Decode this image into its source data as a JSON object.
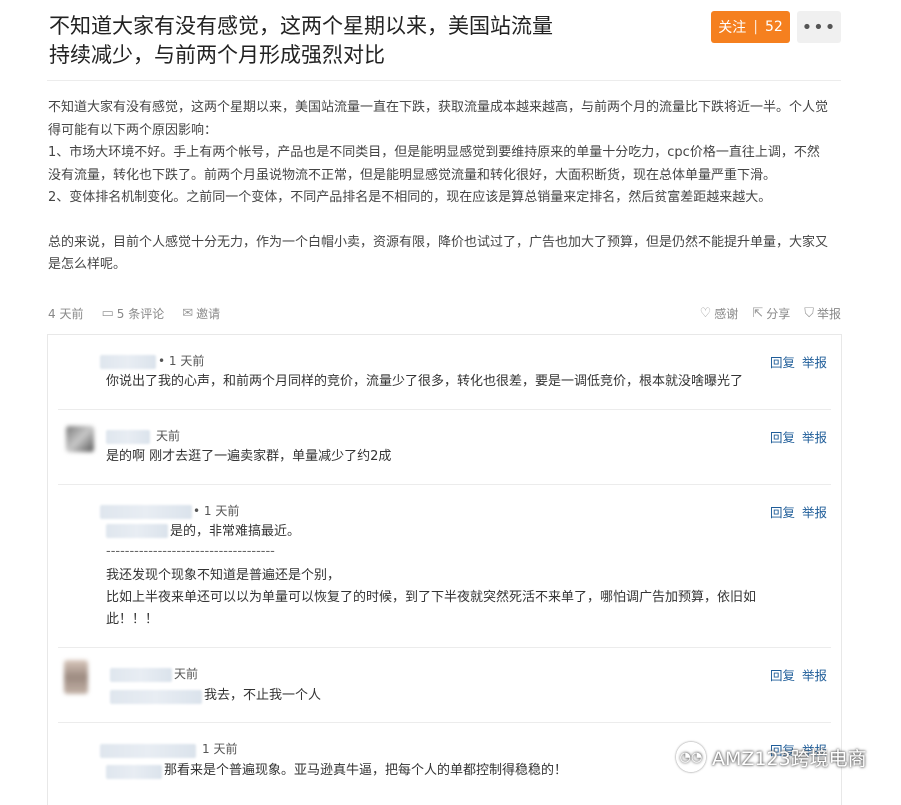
{
  "post": {
    "title": "不知道大家有没有感觉，这两个星期以来，美国站流量持续减少，与前两个月形成强烈对比",
    "follow_label": "关注",
    "follow_count": "52",
    "more_label": "•••",
    "paragraphs": [
      "不知道大家有没有感觉，这两个星期以来，美国站流量一直在下跌，获取流量成本越来越高，与前两个月的流量比下跌将近一半。个人觉得可能有以下两个原因影响：",
      "1、市场大环境不好。手上有两个帐号，产品也是不同类目，但是能明显感觉到要维持原来的单量十分吃力，cpc价格一直往上调，不然没有流量，转化也下跌了。前两个月虽说物流不正常，但是能明显感觉流量和转化很好，大面积断货，现在总体单量严重下滑。",
      "2、变体排名机制变化。之前同一个变体，不同产品排名是不相同的，现在应该是算总销量来定排名，然后贫富差距越来越大。",
      "总的来说，目前个人感觉十分无力，作为一个白帽小卖，资源有限，降价也试过了，广告也加大了预算，但是仍然不能提升单量，大家又是怎么样呢。"
    ],
    "meta": {
      "time": "4 天前",
      "comments": "5 条评论",
      "invite": "邀请"
    },
    "actions": {
      "thanks": "感谢",
      "share": "分享",
      "report": "举报"
    }
  },
  "comments": [
    {
      "time": "• 1 天前",
      "text": "你说出了我的心声，和前两个月同样的竞价，流量少了很多，转化也很差，要是一调低竞价，根本就没啥曝光了",
      "reply": "回复",
      "report": "举报"
    },
    {
      "time": "天前",
      "text": "是的啊 刚才去逛了一遍卖家群，单量减少了约2成",
      "reply": "回复",
      "report": "举报"
    },
    {
      "time": "• 1 天前",
      "text": "是的，非常难搞最近。",
      "dashes": "------------------------------------",
      "text2": "我还发现个现象不知道是普遍还是个别，",
      "text3": "比如上半夜来单还可以以为单量可以恢复了的时候，到了下半夜就突然死活不来单了，哪怕调广告加预算，依旧如",
      "text4": "此！！！",
      "reply": "回复",
      "report": "举报"
    },
    {
      "time": "天前",
      "text": "我去，不止我一个人",
      "reply": "回复",
      "report": "举报"
    },
    {
      "time": "1 天前",
      "text": "那看来是个普遍现象。亚马逊真牛逼，把每个人的单都控制得稳稳的！",
      "reply": "回复",
      "report": "举报"
    }
  ],
  "watermark": "AMZ123跨境电商",
  "colors": {
    "accent": "#f5801f",
    "link": "#1f5d99"
  }
}
